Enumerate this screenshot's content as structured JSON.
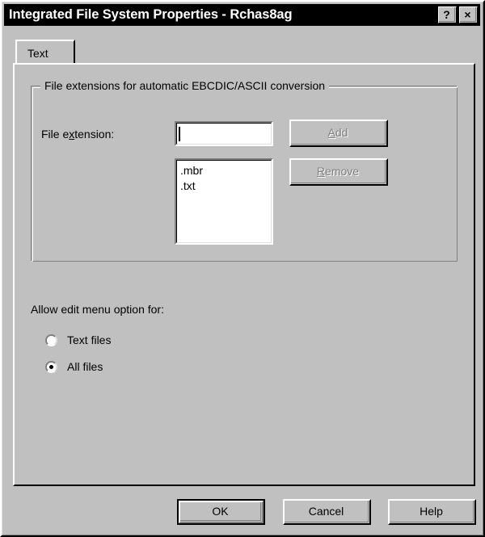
{
  "window": {
    "title": "Integrated File System Properties - Rchas8ag",
    "caption_buttons": [
      {
        "name": "help-caption-button",
        "glyph": "?"
      },
      {
        "name": "close-caption-button",
        "glyph": "×"
      }
    ],
    "background_color": "#c0c0c0",
    "titlebar_color": "#000000",
    "titlebar_text_color": "#ffffff"
  },
  "tabs": [
    {
      "label": "Text",
      "selected": true
    }
  ],
  "groupbox": {
    "title": "File extensions for automatic EBCDIC/ASCII conversion"
  },
  "fields": {
    "file_extension_label_pre": "File e",
    "file_extension_label_accel": "x",
    "file_extension_label_post": "tension:",
    "file_extension_label_full": "File extension:",
    "file_extension_value": "",
    "file_extension_placeholder": ""
  },
  "extension_list": {
    "items": [
      ".mbr",
      ".txt"
    ]
  },
  "list_buttons": [
    {
      "label": "Add",
      "accel": "A",
      "label_pre": "",
      "label_accel": "A",
      "label_post": "dd",
      "enabled": false
    },
    {
      "label": "Remove",
      "accel": "R",
      "label_pre": "",
      "label_accel": "R",
      "label_post": "emove",
      "enabled": false
    }
  ],
  "edit_menu": {
    "heading": "Allow edit menu option for:",
    "options": [
      {
        "label": "Text files",
        "selected": false
      },
      {
        "label": "All files",
        "selected": true
      }
    ]
  },
  "dialog_buttons": [
    {
      "label": "OK",
      "default": true
    },
    {
      "label": "Cancel",
      "default": false
    },
    {
      "label": "Help",
      "default": false
    }
  ]
}
